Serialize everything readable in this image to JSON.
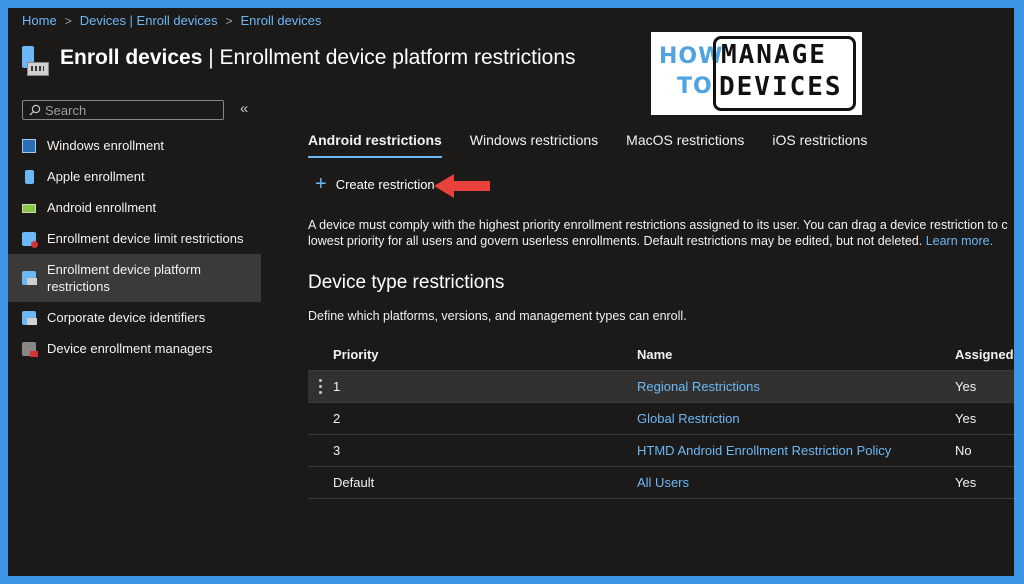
{
  "breadcrumb": [
    "Home",
    "Devices | Enroll devices",
    "Enroll devices"
  ],
  "header": {
    "title_main": "Enroll devices",
    "title_separator": " | ",
    "title_sub": "Enrollment device platform restrictions"
  },
  "logo": {
    "how": "HOW",
    "to": "TO",
    "manage": "MANAGE",
    "devices": "DEVICES"
  },
  "search": {
    "placeholder": "Search",
    "value": "",
    "collapse_glyph": "«"
  },
  "sidebar": {
    "items": [
      {
        "label": "Windows enrollment",
        "icon": "windows-enrollment-icon"
      },
      {
        "label": "Apple enrollment",
        "icon": "apple-enrollment-icon"
      },
      {
        "label": "Android enrollment",
        "icon": "android-enrollment-icon"
      },
      {
        "label": "Enrollment device limit restrictions",
        "icon": "device-limit-icon"
      },
      {
        "label": "Enrollment device platform restrictions",
        "icon": "platform-restrictions-icon",
        "active": true
      },
      {
        "label": "Corporate device identifiers",
        "icon": "corporate-identifiers-icon"
      },
      {
        "label": "Device enrollment managers",
        "icon": "enrollment-managers-icon"
      }
    ]
  },
  "tabs": [
    "Android restrictions",
    "Windows restrictions",
    "MacOS restrictions",
    "iOS restrictions"
  ],
  "active_tab": "Android restrictions",
  "toolbar": {
    "create_label": "Create restriction"
  },
  "description": {
    "line1": "A device must comply with the highest priority enrollment restrictions assigned to its user. You can drag a device restriction to c",
    "line2": "lowest priority for all users and govern userless enrollments. Default restrictions may be edited, but not deleted.",
    "learn_more": "Learn more."
  },
  "section": {
    "title": "Device type restrictions",
    "subtitle": "Define which platforms, versions, and management types can enroll."
  },
  "table": {
    "columns": [
      "Priority",
      "Name",
      "Assigned"
    ],
    "rows": [
      {
        "priority": "1",
        "name": "Regional Restrictions",
        "assigned": "Yes"
      },
      {
        "priority": "2",
        "name": "Global Restriction",
        "assigned": "Yes"
      },
      {
        "priority": "3",
        "name": "HTMD Android Enrollment Restriction Policy",
        "assigned": "No"
      },
      {
        "priority": "Default",
        "name": "All Users",
        "assigned": "Yes"
      }
    ]
  },
  "colors": {
    "accent": "#6cb8f6",
    "background": "#1b1a19",
    "frame_border": "#3d93e6",
    "arrow": "#e8413b"
  }
}
